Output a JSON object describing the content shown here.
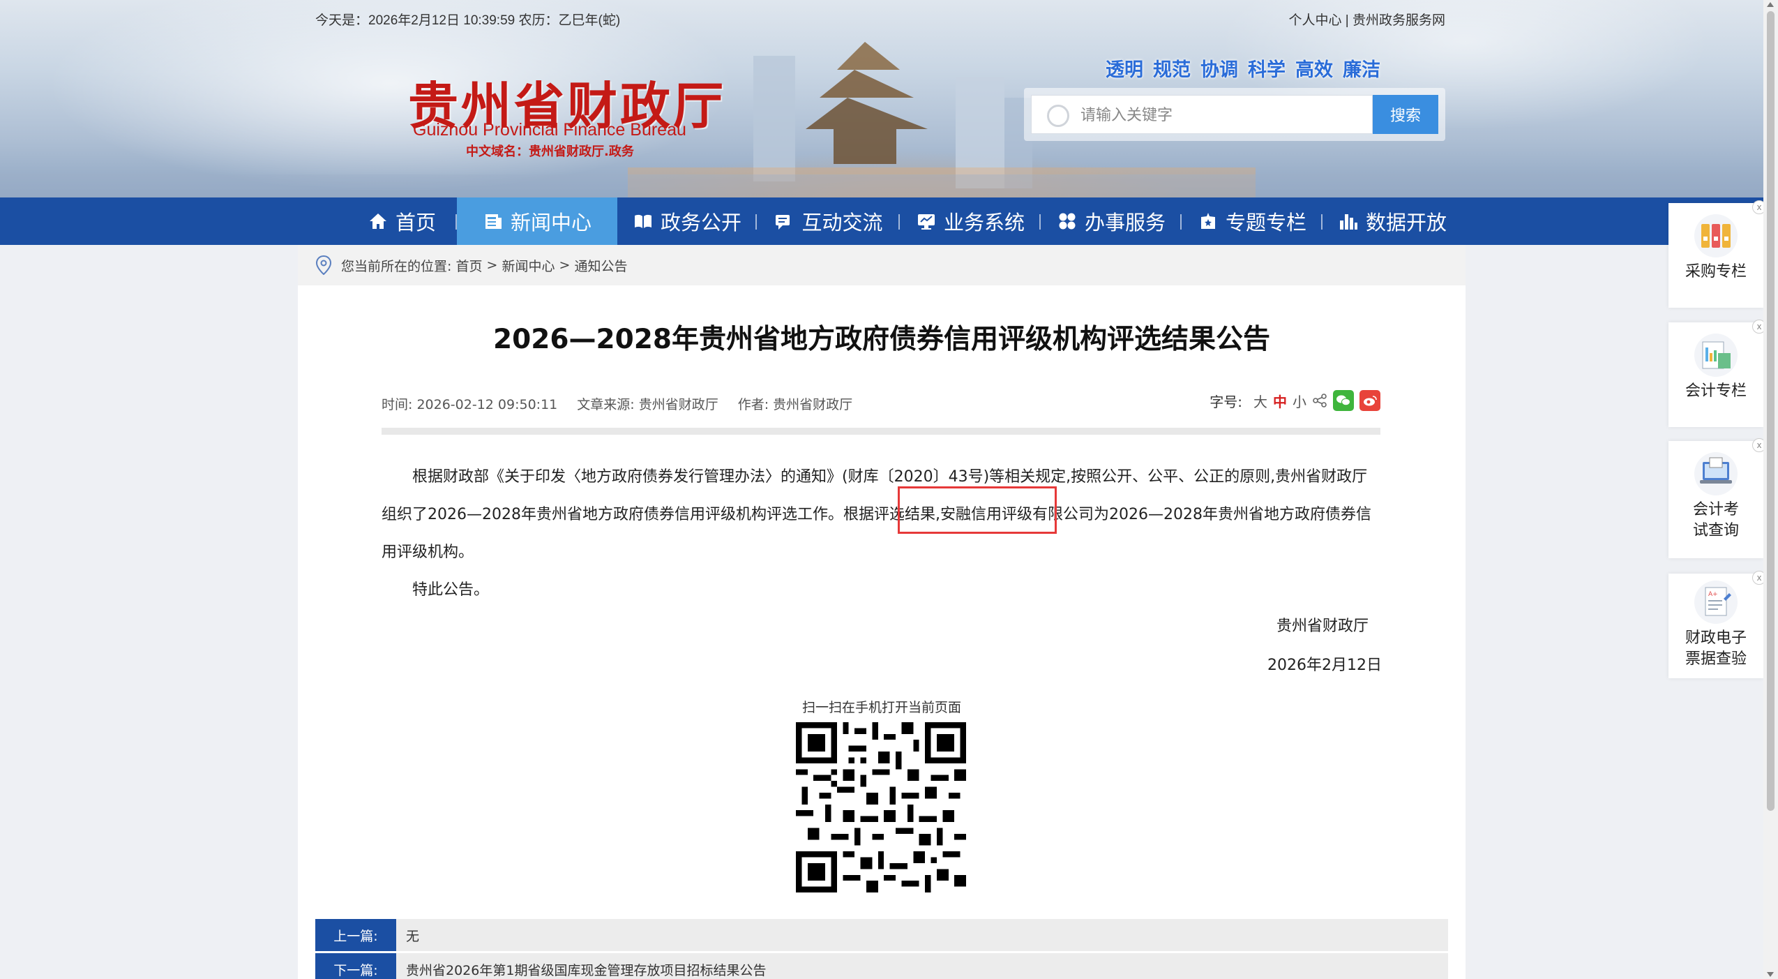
{
  "header": {
    "date_line": "今天是：2026年2月12日 10:39:59 农历：乙巳年(蛇)",
    "user_center": "个人中心",
    "separator": "|",
    "gov_service": "贵州政务服务网",
    "logo_cn": "贵州省财政厅",
    "logo_en": "Guizhou Provincial Finance Bureau",
    "logo_domain": "中文域名：贵州省财政厅.政务",
    "slogans": [
      "透明",
      "规范",
      "协调",
      "科学",
      "高效",
      "廉洁"
    ],
    "search": {
      "placeholder": "请输入关键字",
      "button": "搜索"
    }
  },
  "nav": {
    "items": [
      {
        "label": "首页",
        "icon": "home-icon"
      },
      {
        "label": "新闻中心",
        "icon": "news-icon"
      },
      {
        "label": "政务公开",
        "icon": "book-icon"
      },
      {
        "label": "互动交流",
        "icon": "chat-icon"
      },
      {
        "label": "业务系统",
        "icon": "monitor-icon"
      },
      {
        "label": "办事服务",
        "icon": "grid-icon"
      },
      {
        "label": "专题专栏",
        "icon": "badge-icon"
      },
      {
        "label": "数据开放",
        "icon": "bar-chart-icon"
      }
    ],
    "active_index": 1,
    "color": "#1b4fa3",
    "active_color": "#4a9de0"
  },
  "breadcrumb": {
    "prefix": "您当前所在的位置:",
    "items": [
      "首页",
      "新闻中心",
      "通知公告"
    ],
    "separator": ">"
  },
  "article": {
    "title": "2026—2028年贵州省地方政府债券信用评级机构评选结果公告",
    "time_label": "时间:",
    "time": "2026-02-12 09:50:11",
    "source_label": "文章来源:",
    "source": "贵州省财政厅",
    "author_label": "作者:",
    "author": "贵州省财政厅",
    "fontsize_label": "字号:",
    "fontsize_options": [
      "大",
      "中",
      "小"
    ],
    "paragraph_1": "根据财政部《关于印发〈地方政府债券发行管理办法〉的通知》(财库〔2020〕43号)等相关规定,按照公开、公平、公正的原则,贵州省财政厅组织了2026—2028年贵州省地方政府债券信用评级机构评选工作。根据评选结果,安融信用评级有限公司为2026—2028年贵州省地方政府债券信用评级机构。",
    "paragraph_2": "特此公告。",
    "sign_org": "贵州省财政厅",
    "sign_date": "2026年2月12日",
    "qr_caption": "扫一扫在手机打开当前页面",
    "highlight_color": "#e63939"
  },
  "prev_next": {
    "prev_label": "上一篇:",
    "prev_value": "无",
    "next_label": "下一篇:",
    "next_value": "贵州省2026年第1期省级国库现金管理存放项目招标结果公告"
  },
  "sidebar_float": [
    {
      "label": "采购专栏",
      "icon": "folders-icon"
    },
    {
      "label": "会计专栏",
      "icon": "ledger-icon"
    },
    {
      "label": "会计考试查询",
      "icon": "laptop-icon"
    },
    {
      "label": "财政电子票据查验",
      "icon": "document-icon"
    }
  ]
}
